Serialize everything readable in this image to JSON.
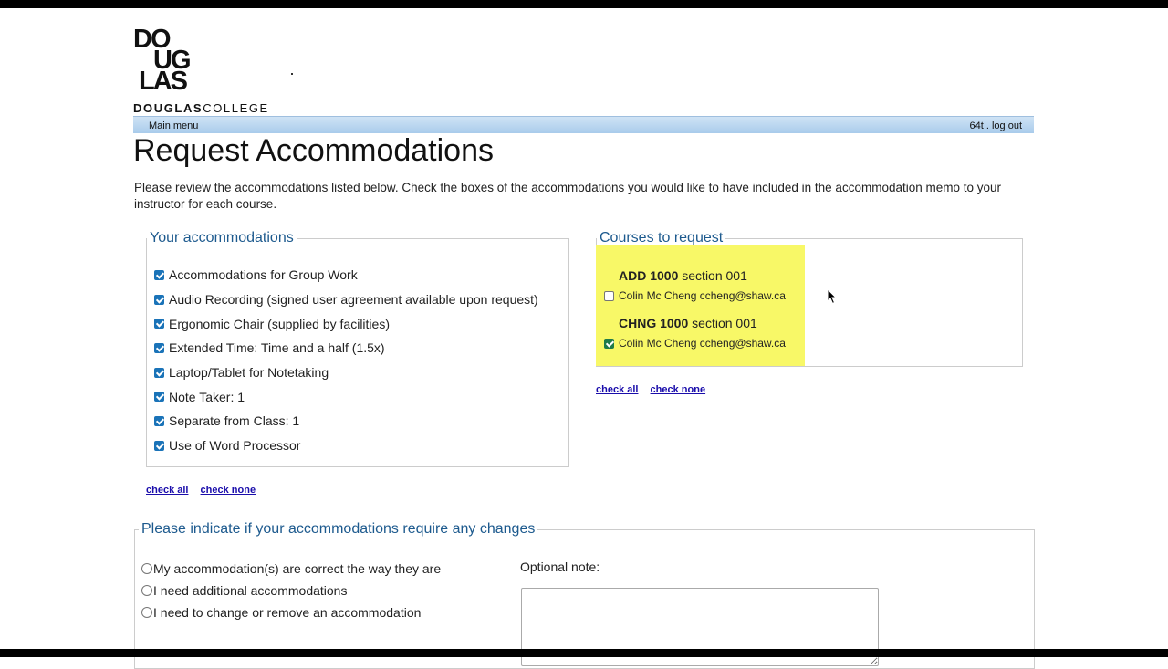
{
  "logo": {
    "line1": "DO",
    "line2": "UG",
    "line3": "LAS",
    "word_bold": "DOUGLAS",
    "word_light": "COLLEGE"
  },
  "nav": {
    "left": "Main menu",
    "user": "64t",
    "separator": " . ",
    "logout": "log out"
  },
  "page": {
    "title": "Request Accommodations",
    "intro": "Please review the accommodations listed below. Check the boxes of the accommodations you would like to have included in the accommodation memo to your instructor for each course."
  },
  "accommodations": {
    "legend": "Your accommodations",
    "items": [
      {
        "label": "Accommodations for Group Work",
        "checked": true
      },
      {
        "label": "Audio Recording (signed user agreement available upon request)",
        "checked": true
      },
      {
        "label": "Ergonomic Chair (supplied by facilities)",
        "checked": true
      },
      {
        "label": "Extended Time: Time and a half (1.5x)",
        "checked": true
      },
      {
        "label": "Laptop/Tablet for Notetaking",
        "checked": true
      },
      {
        "label": "Note Taker: 1",
        "checked": true
      },
      {
        "label": "Separate from Class: 1",
        "checked": true
      },
      {
        "label": "Use of Word Processor",
        "checked": true
      }
    ],
    "check_all": "check all",
    "check_none": "check none"
  },
  "courses": {
    "legend": "Courses to request",
    "items": [
      {
        "code": "ADD 1000",
        "section": "section 001",
        "instructor": "Colin Mc Cheng ccheng@shaw.ca",
        "checked": false
      },
      {
        "code": "CHNG 1000",
        "section": "section 001",
        "instructor": "Colin Mc Cheng ccheng@shaw.ca",
        "checked": true
      }
    ],
    "check_all": "check all",
    "check_none": "check none",
    "highlight_color": "#f8f867"
  },
  "changes": {
    "legend": "Please indicate if your accommodations require any changes",
    "options": [
      "My accommodation(s) are correct the way they are",
      "I need additional accommodations",
      "I need to change or remove an accommodation"
    ],
    "note_label": "Optional note:",
    "note_value": ""
  },
  "colors": {
    "legend": "#1d5a8e",
    "nav_bar": "#a9cbeb",
    "checkbox": "#1a73b8"
  }
}
